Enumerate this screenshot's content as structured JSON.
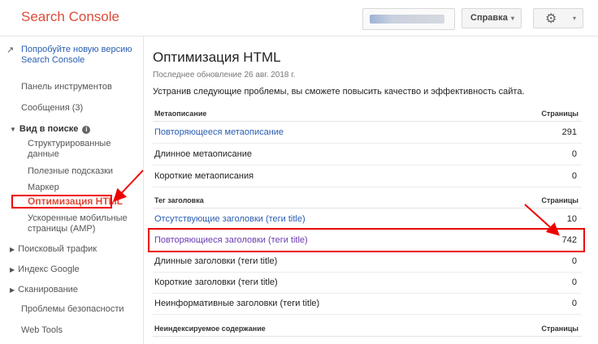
{
  "header": {
    "logo": "Search Console",
    "help_label": "Справка",
    "caret": "▾",
    "gear": "⚙"
  },
  "sidebar": {
    "promo": "Попробуйте новую версию Search Console",
    "items": [
      "Панель инструментов",
      "Сообщения (3)",
      "Вид в поиске",
      "Структурированные данные",
      "Полезные подсказки",
      "Маркер",
      "Оптимизация HTML",
      "Ускоренные мобильные страницы (AMP)",
      "Поисковый трафик",
      "Индекс Google",
      "Сканирование",
      "Проблемы безопасности",
      "Web Tools"
    ],
    "info": "i"
  },
  "main": {
    "title": "Оптимизация HTML",
    "updated": "Последнее обновление 26 авг. 2018 г.",
    "intro": "Устранив следующие проблемы, вы сможете повысить качество и эффективность сайта.",
    "sections": [
      {
        "heading": "Метаописание",
        "col": "Страницы",
        "rows": [
          {
            "label": "Повторяющееся метаописание",
            "value": "291"
          },
          {
            "label": "Длинное метаописание",
            "value": "0"
          },
          {
            "label": "Короткие метаописания",
            "value": "0"
          }
        ]
      },
      {
        "heading": "Тег заголовка",
        "col": "Страницы",
        "rows": [
          {
            "label": "Отсутствующие заголовки (теги title)",
            "value": "10"
          },
          {
            "label": "Повторяющиеся заголовки (теги title)",
            "value": "742"
          },
          {
            "label": "Длинные заголовки (теги title)",
            "value": "0"
          },
          {
            "label": "Короткие заголовки (теги title)",
            "value": "0"
          },
          {
            "label": "Неинформативные заголовки (теги title)",
            "value": "0"
          }
        ]
      },
      {
        "heading": "Неиндексируемое содержание",
        "col": "Страницы"
      }
    ]
  },
  "colors": {
    "brand": "#dd4b39",
    "link": "#2a5db0",
    "annotation": "#ee0000"
  }
}
